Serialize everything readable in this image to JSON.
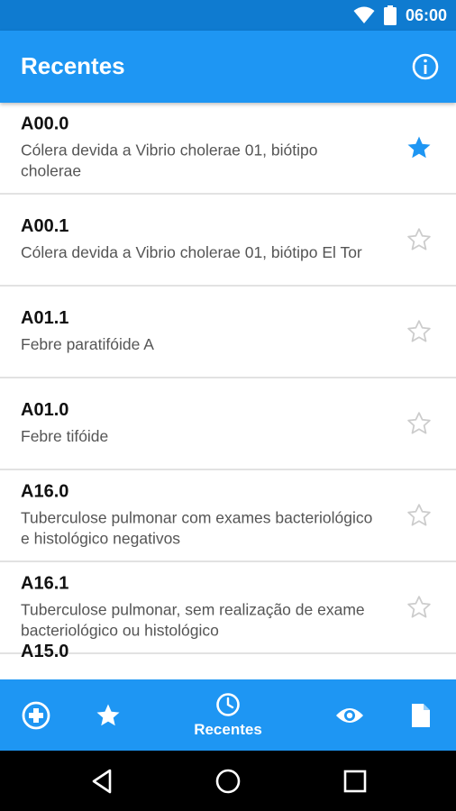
{
  "status_bar": {
    "time": "06:00",
    "icons": [
      "wifi-icon",
      "battery-icon"
    ]
  },
  "app_bar": {
    "title": "Recentes",
    "action_icon": "info-icon"
  },
  "items": [
    {
      "code": "A00.0",
      "description": "Cólera devida a Vibrio cholerae 01, biótipo cholerae",
      "favorite": true
    },
    {
      "code": "A00.1",
      "description": "Cólera devida a Vibrio cholerae 01, biótipo El Tor",
      "favorite": false
    },
    {
      "code": "A01.1",
      "description": "Febre paratifóide A",
      "favorite": false
    },
    {
      "code": "A01.0",
      "description": "Febre tifóide",
      "favorite": false
    },
    {
      "code": "A16.0",
      "description": "Tuberculose pulmonar com exames bacteriológico e histológico negativos",
      "favorite": false
    },
    {
      "code": "A16.1",
      "description": "Tuberculose pulmonar, sem realização de exame bacteriológico ou histológico",
      "favorite": false
    },
    {
      "code": "A15.0",
      "description": "",
      "favorite": false
    }
  ],
  "bottom_nav": {
    "items": [
      {
        "icon": "medical-cross-icon",
        "label": ""
      },
      {
        "icon": "star-icon",
        "label": ""
      },
      {
        "icon": "clock-icon",
        "label": "Recentes",
        "active": true
      },
      {
        "icon": "eye-icon",
        "label": ""
      },
      {
        "icon": "document-icon",
        "label": ""
      }
    ]
  },
  "colors": {
    "primary": "#1e96f3",
    "status_bar": "#0f7bd0",
    "star_filled": "#1e96f3",
    "star_outline": "#cccccc"
  }
}
